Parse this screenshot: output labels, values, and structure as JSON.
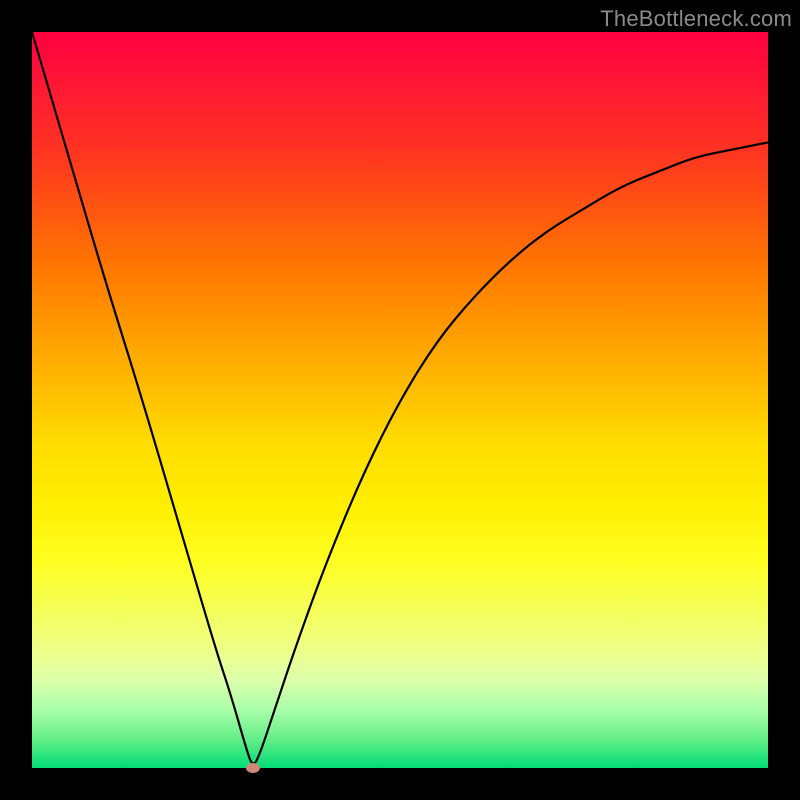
{
  "watermark": "TheBottleneck.com",
  "chart_data": {
    "type": "line",
    "title": "",
    "xlabel": "",
    "ylabel": "",
    "xlim": [
      0,
      100
    ],
    "ylim": [
      0,
      100
    ],
    "grid": false,
    "legend": false,
    "background_gradient": {
      "top_color": "#ff0040",
      "bottom_color": "#00dd77",
      "description": "vertical gradient red→orange→yellow→green"
    },
    "series": [
      {
        "name": "bottleneck-curve",
        "color": "#000000",
        "x": [
          0,
          5,
          10,
          15,
          20,
          25,
          27,
          29,
          30,
          31,
          33,
          36,
          40,
          45,
          50,
          55,
          60,
          65,
          70,
          75,
          80,
          85,
          90,
          95,
          100
        ],
        "values": [
          100,
          83,
          66,
          50,
          33,
          16,
          10,
          3,
          0,
          2,
          8,
          17,
          28,
          40,
          50,
          58,
          64,
          69,
          73,
          76,
          79,
          81,
          83,
          84,
          85
        ]
      }
    ],
    "marker": {
      "name": "optimal-point",
      "x": 30,
      "y": 0,
      "color": "#d08878"
    }
  }
}
